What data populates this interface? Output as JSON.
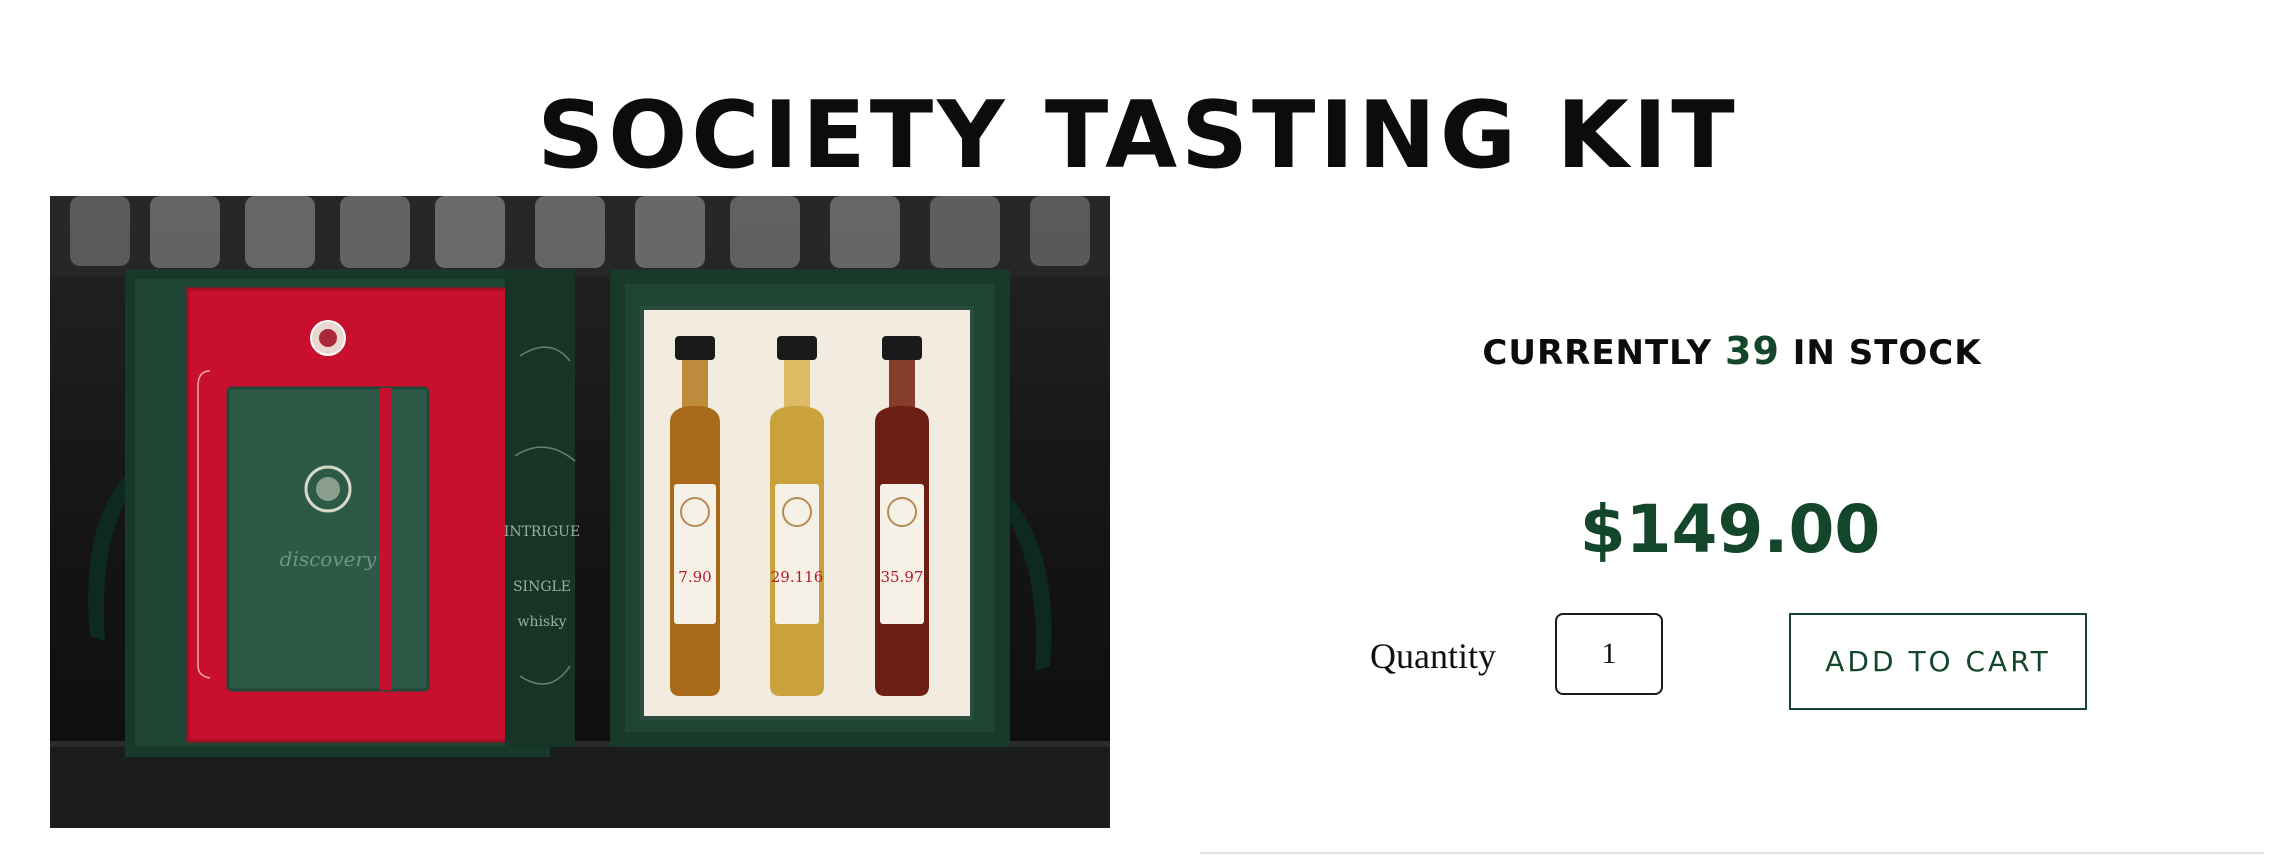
{
  "product": {
    "title": "SOCIETY TASTING KIT",
    "image_alt": "Society Tasting Kit gift box with notebook and three whisky bottles"
  },
  "stock": {
    "prefix": "CURRENTLY",
    "count": "39",
    "suffix": "IN STOCK"
  },
  "price": "$149.00",
  "quantity": {
    "label": "Quantity",
    "value": "1"
  },
  "cart": {
    "label": "ADD TO CART"
  },
  "colors": {
    "brand_green": "#14462b",
    "box_red": "#c8102e",
    "box_green": "#17392a"
  },
  "bottles": [
    {
      "label": "7.90"
    },
    {
      "label": "29.116"
    },
    {
      "label": "35.97"
    }
  ],
  "notebook": {
    "cover_text": "discovery"
  }
}
